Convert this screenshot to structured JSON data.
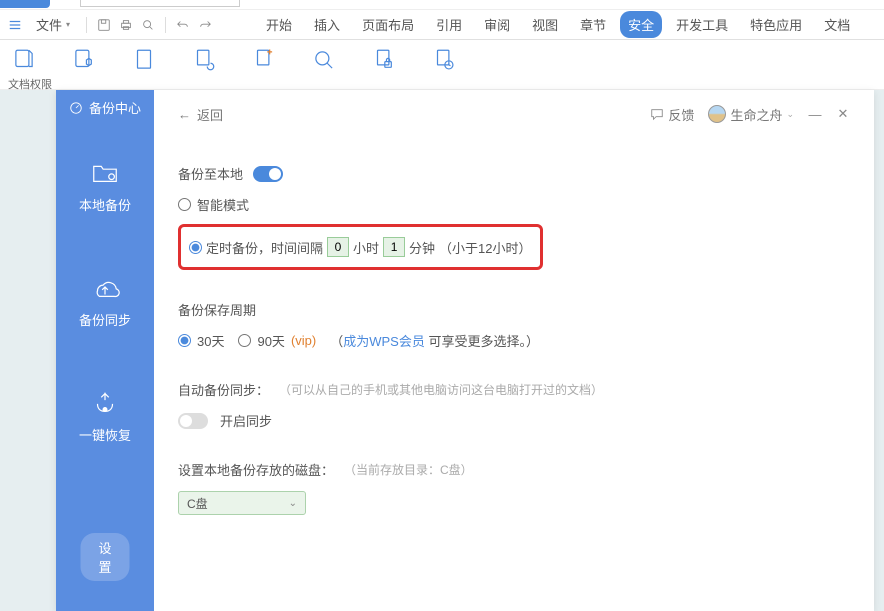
{
  "ribbon": {
    "file_label": "文件",
    "tabs": [
      "开始",
      "插入",
      "页面布局",
      "引用",
      "审阅",
      "视图",
      "章节",
      "安全",
      "开发工具",
      "特色应用",
      "文档"
    ],
    "active_tab_index": 7,
    "group_label": "文档权限"
  },
  "dialog": {
    "title": "备份中心",
    "back": "返回",
    "feedback": "反馈",
    "user": "生命之舟",
    "sidebar": {
      "items": [
        {
          "label": "本地备份"
        },
        {
          "label": "备份同步"
        },
        {
          "label": "一键恢复"
        }
      ],
      "settings": "设置"
    },
    "local_backup": {
      "title": "备份至本地",
      "smart_mode": "智能模式",
      "timed_prefix": "定时备份，时间间隔",
      "hours_value": "0",
      "hours_label": "小时",
      "minutes_value": "1",
      "minutes_label": "分钟",
      "limit_note": "（小于12小时）"
    },
    "retention": {
      "title": "备份保存周期",
      "opt30": "30天",
      "opt90": "90天",
      "vip": "(vip)",
      "left_paren": "（",
      "link": "成为WPS会员",
      "rest": " 可享受更多选择。）"
    },
    "autosync": {
      "title": "自动备份同步：",
      "hint": "（可以从自己的手机或其他电脑访问这台电脑打开过的文档）",
      "enable": "开启同步"
    },
    "disk": {
      "title": "设置本地备份存放的磁盘：",
      "current": "（当前存放目录：C盘）",
      "selected": "C盘"
    }
  }
}
